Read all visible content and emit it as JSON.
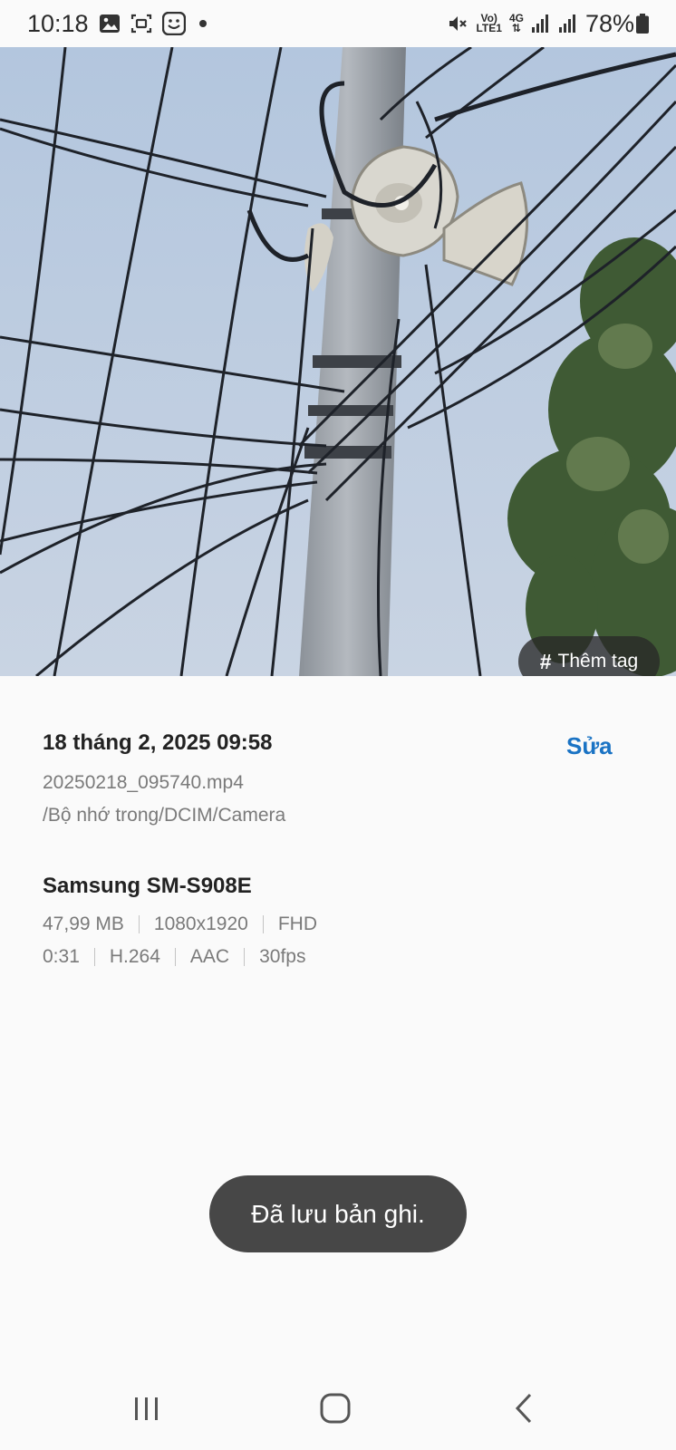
{
  "status_bar": {
    "time": "10:18",
    "net_top": "Vo)",
    "net_bottom": "LTE1",
    "net_type": "4G",
    "battery": "78%",
    "icons": [
      "gallery-icon",
      "screen-capture-icon",
      "face-widget-icon",
      "notification-dot-icon",
      "mute-icon",
      "volte-icon",
      "4g-data-icon",
      "signal-sim1-icon",
      "signal-sim2-icon",
      "battery-icon"
    ]
  },
  "photo": {
    "tag_hash": "#",
    "tag_label": "Thêm tag"
  },
  "details": {
    "date": "18 tháng 2, 2025 09:58",
    "edit_label": "Sửa",
    "file_name": "20250218_095740.mp4",
    "file_path": "/Bộ nhớ trong/DCIM/Camera",
    "device": "Samsung SM-S908E",
    "meta_row1": [
      "47,99 MB",
      "1080x1920",
      "FHD"
    ],
    "meta_row2": [
      "0:31",
      "H.264",
      "AAC",
      "30fps"
    ]
  },
  "toast": {
    "message": "Đã lưu bản ghi."
  },
  "nav_bar": {
    "icons": [
      "recent-apps-icon",
      "home-icon",
      "back-icon"
    ]
  },
  "colors": {
    "accent": "#1a73c4",
    "background": "#fafafa",
    "toast_bg": "#474747",
    "tag_bg": "#2a2a2a"
  }
}
